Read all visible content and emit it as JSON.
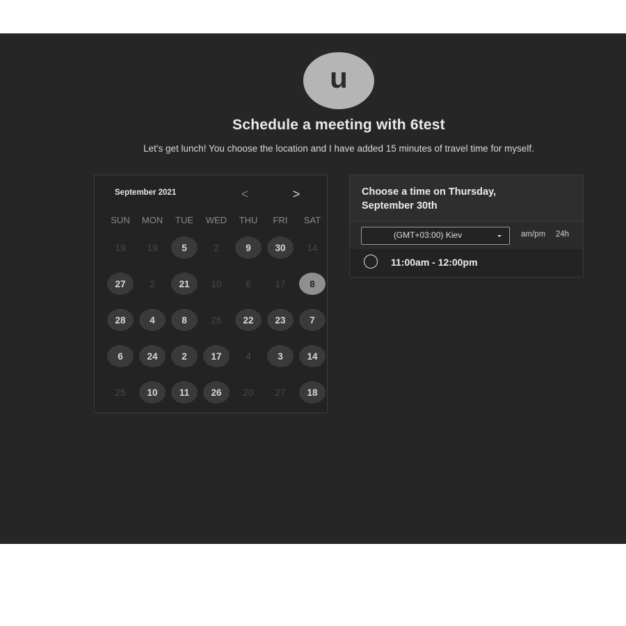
{
  "profile": {
    "avatar_letter": "u"
  },
  "header": {
    "title": "Schedule a meeting with 6test",
    "description": "Let's get lunch! You choose the location and I have added 15 minutes of travel time for myself."
  },
  "calendar": {
    "month_label": "September 2021",
    "prev_icon": "<",
    "next_icon": ">",
    "weekdays": [
      "SUN",
      "MON",
      "TUE",
      "WED",
      "THU",
      "FRI",
      "SAT"
    ],
    "weeks": [
      [
        {
          "label": "19",
          "state": "inactive"
        },
        {
          "label": "19",
          "state": "inactive"
        },
        {
          "label": "5",
          "state": "active"
        },
        {
          "label": "2",
          "state": "inactive"
        },
        {
          "label": "9",
          "state": "active"
        },
        {
          "label": "30",
          "state": "active"
        },
        {
          "label": "14",
          "state": "inactive"
        }
      ],
      [
        {
          "label": "27",
          "state": "active"
        },
        {
          "label": "2",
          "state": "inactive"
        },
        {
          "label": "21",
          "state": "active"
        },
        {
          "label": "10",
          "state": "inactive"
        },
        {
          "label": "6",
          "state": "inactive"
        },
        {
          "label": "17",
          "state": "inactive"
        },
        {
          "label": "8",
          "state": "selected"
        }
      ],
      [
        {
          "label": "28",
          "state": "active"
        },
        {
          "label": "4",
          "state": "active"
        },
        {
          "label": "8",
          "state": "active"
        },
        {
          "label": "26",
          "state": "inactive"
        },
        {
          "label": "22",
          "state": "active"
        },
        {
          "label": "23",
          "state": "active"
        },
        {
          "label": "7",
          "state": "active"
        }
      ],
      [
        {
          "label": "6",
          "state": "active"
        },
        {
          "label": "24",
          "state": "active"
        },
        {
          "label": "2",
          "state": "active"
        },
        {
          "label": "17",
          "state": "active"
        },
        {
          "label": "4",
          "state": "inactive"
        },
        {
          "label": "3",
          "state": "active"
        },
        {
          "label": "14",
          "state": "active"
        }
      ],
      [
        {
          "label": "25",
          "state": "inactive"
        },
        {
          "label": "10",
          "state": "active"
        },
        {
          "label": "11",
          "state": "active"
        },
        {
          "label": "26",
          "state": "active"
        },
        {
          "label": "20",
          "state": "inactive"
        },
        {
          "label": "27",
          "state": "inactive"
        },
        {
          "label": "18",
          "state": "active"
        }
      ]
    ]
  },
  "time_panel": {
    "heading": "Choose a time on Thursday, September 30th",
    "timezone": "(GMT+03:00) Kiev",
    "format_ampm": "am/pm",
    "format_24h": "24h",
    "slots": [
      {
        "label": "11:00am - 12:00pm"
      }
    ]
  },
  "colors": {
    "background": "#262626",
    "day_active": "#3a3a3a",
    "day_selected": "#8f8f8f",
    "avatar": "#b5b5b5"
  }
}
